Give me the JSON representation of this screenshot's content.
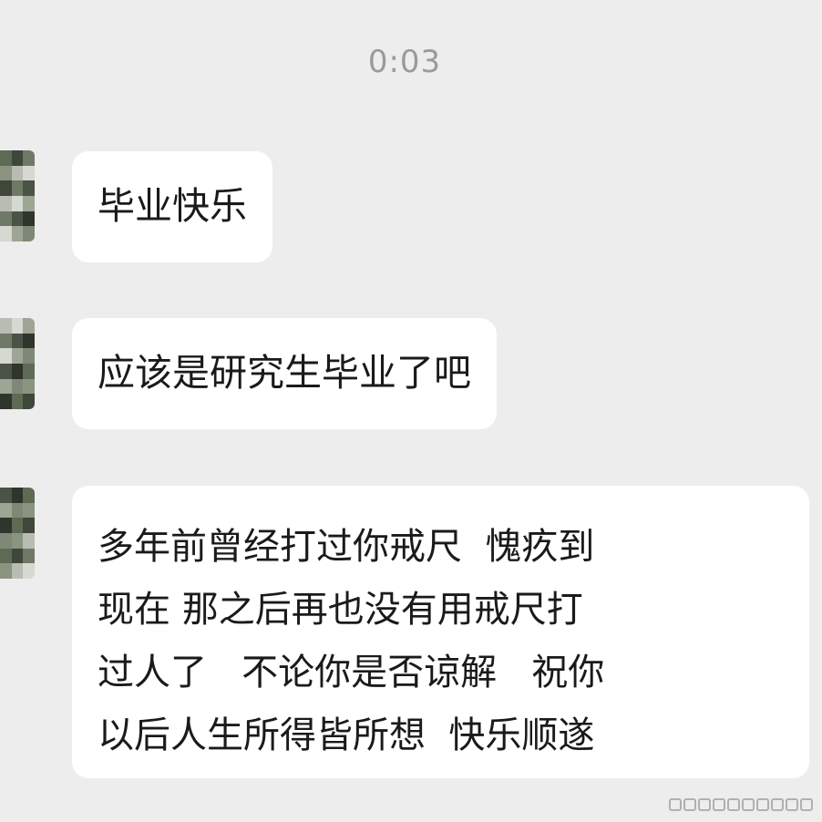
{
  "chat": {
    "timestamp": "0:03",
    "messages": [
      {
        "text": "毕业快乐"
      },
      {
        "text": "应该是研究生毕业了吧"
      },
      {
        "lines": [
          "多年前曾经打过你戒尺  愧疚到",
          "现在 那之后再也没有用戒尺打",
          "过人了   不论你是否谅解   祝你",
          "以后人生所得皆所想  快乐顺遂"
        ]
      }
    ]
  },
  "colors": {
    "background": "#ededed",
    "bubble": "#ffffff",
    "text": "#1a1a1a",
    "timestamp": "#9a9a9a"
  },
  "icons": {
    "avatar": "pixelated-avatar-icon",
    "watermark": "weibo-watermark-icon"
  }
}
